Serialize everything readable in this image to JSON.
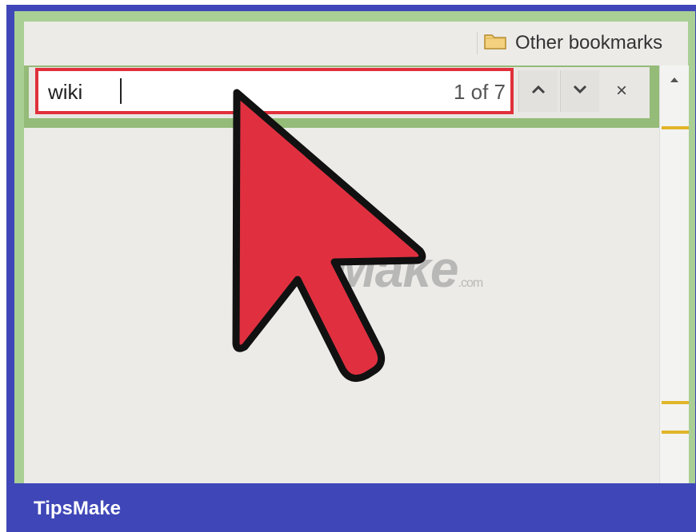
{
  "bookmarks_bar": {
    "other_bookmarks": {
      "label": "Other bookmarks",
      "icon": "folder-icon"
    }
  },
  "find_bar": {
    "query": "wiki",
    "match_count": "1 of 7",
    "prev_icon": "chevron-up-icon",
    "next_icon": "chevron-down-icon",
    "close_label": "×"
  },
  "cursor": {
    "icon": "mouse-pointer-icon",
    "color": "#e03040"
  },
  "watermark": {
    "text": "TipsMake",
    "suffix": ".com"
  },
  "footer": {
    "brand": "TipsMake"
  },
  "colors": {
    "highlight_border": "#e0303b",
    "frame": "#3f47b8",
    "browser_chrome": "#a9cf95",
    "scroll_marks": "#e0b52a"
  }
}
